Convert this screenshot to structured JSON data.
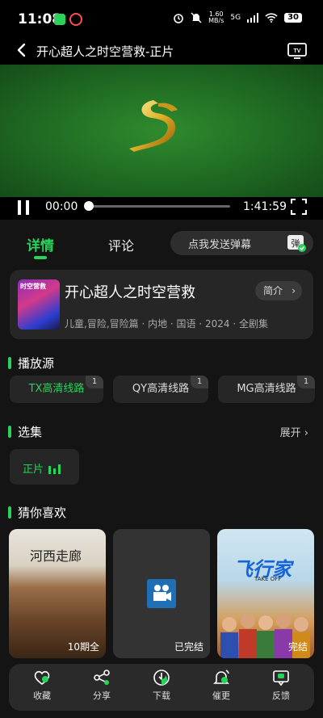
{
  "status_bar": {
    "time": "11:08",
    "speed_value": "1.60",
    "speed_unit": "MB/s",
    "network": "5G",
    "battery": "30"
  },
  "header": {
    "title": "开心超人之时空营救-正片"
  },
  "player": {
    "current_time": "00:00",
    "total_time": "1:41:59",
    "progress": 0.0
  },
  "tabs": {
    "details": "详情",
    "comments": "评论",
    "danmaku_placeholder": "点我发送弹幕",
    "danmaku_icon_text": "弹"
  },
  "info": {
    "title": "开心超人之时空营救",
    "intro_label": "简介",
    "meta": "儿童,冒险,冒险篇 · 内地 · 国语 · 2024 · 全剧集",
    "poster_text": "时空营救"
  },
  "sources": {
    "heading": "播放源",
    "items": [
      {
        "label": "TX高清线路",
        "badge": "1",
        "active": true
      },
      {
        "label": "QY高清线路",
        "badge": "1",
        "active": false
      },
      {
        "label": "MG高清线路",
        "badge": "1",
        "active": false
      }
    ]
  },
  "episodes": {
    "heading": "选集",
    "expand_label": "展开",
    "items": [
      {
        "label": "正片"
      }
    ]
  },
  "recommend": {
    "heading": "猜你喜欢",
    "items": [
      {
        "poster_text": "河西走廊",
        "status": "10期全"
      },
      {
        "poster_text": "",
        "status": "已完结"
      },
      {
        "poster_text": "飞行家",
        "poster_subtext": "TAKE OFF",
        "status": "完结"
      }
    ]
  },
  "bottom_nav": [
    {
      "label": "收藏",
      "icon": "heart-icon"
    },
    {
      "label": "分享",
      "icon": "share-icon"
    },
    {
      "label": "下载",
      "icon": "download-icon"
    },
    {
      "label": "催更",
      "icon": "bell-icon"
    },
    {
      "label": "反馈",
      "icon": "feedback-icon"
    }
  ],
  "colors": {
    "accent": "#27d35b",
    "background": "#141414",
    "card": "#262626"
  }
}
